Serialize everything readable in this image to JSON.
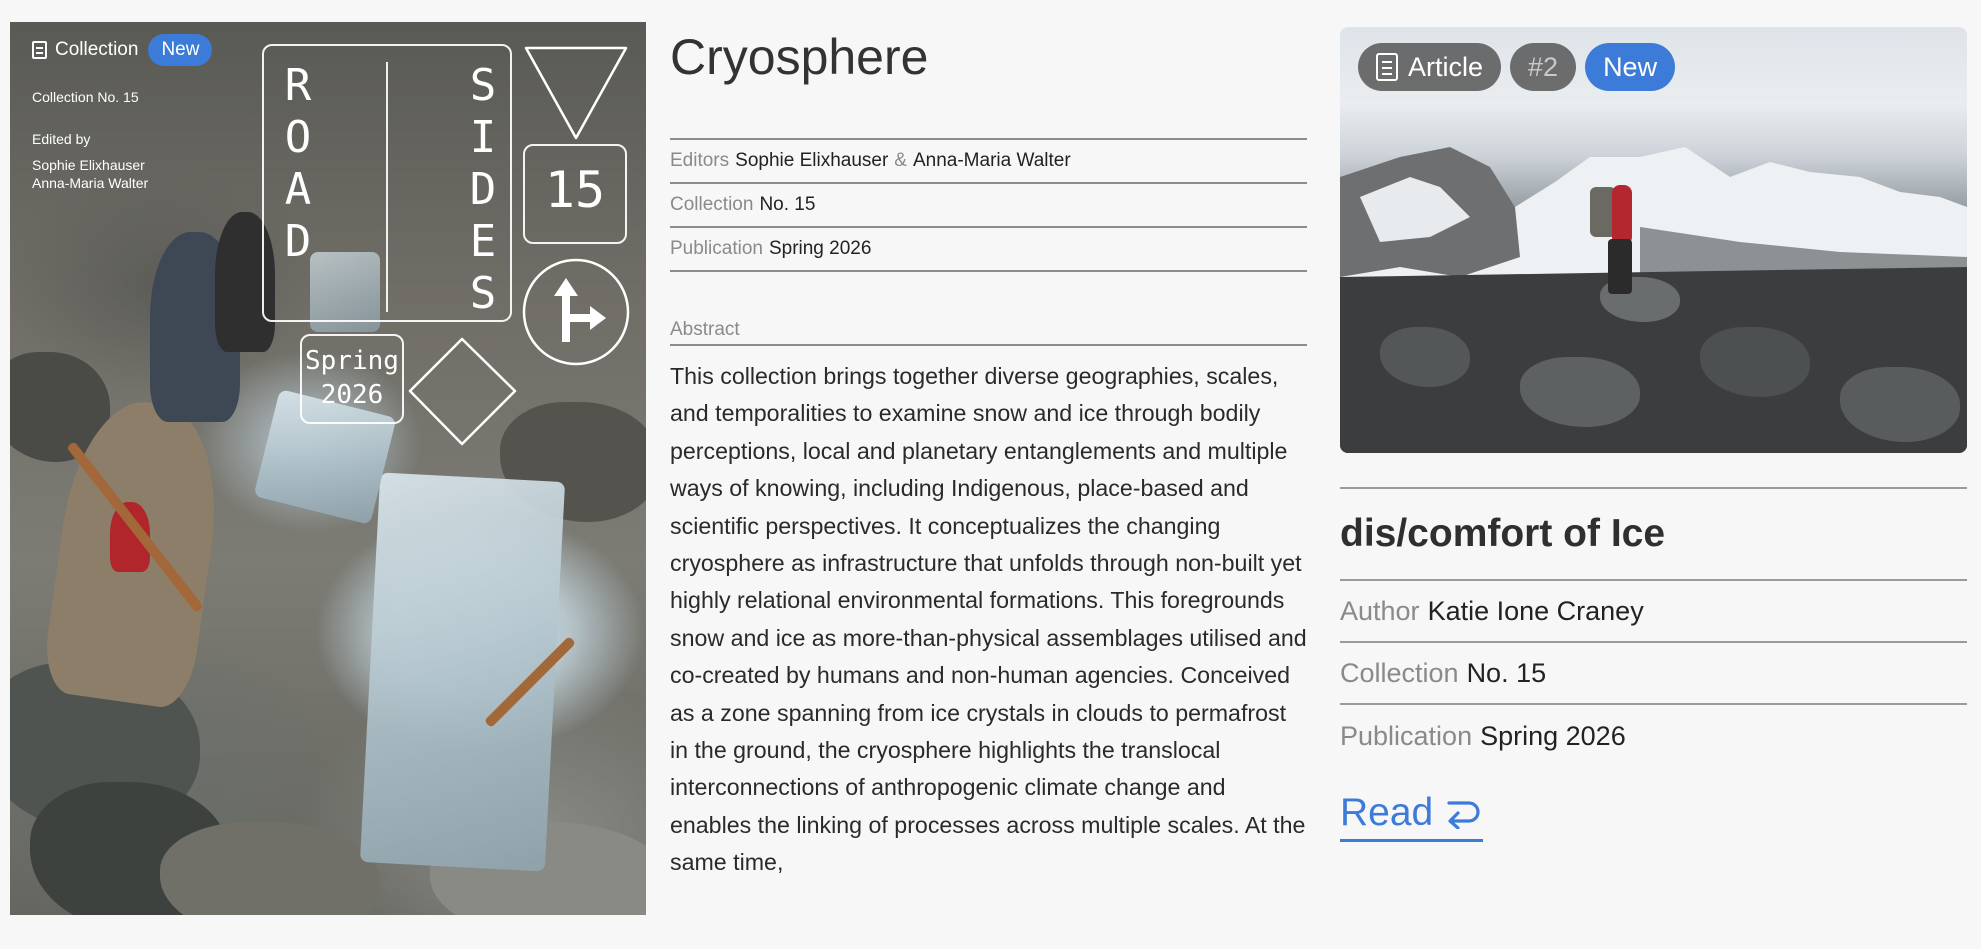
{
  "cover": {
    "collection_label": "Collection",
    "new_badge": "New",
    "collection_no": "Collection No. 15",
    "edited_by": "Edited by",
    "editor_1": "Sophie Elixhauser",
    "editor_2": "Anna-Maria Walter",
    "logo_word_1": "ROAD",
    "logo_word_2": "SIDES",
    "logo_number": "15",
    "logo_season": "Spring",
    "logo_year": "2026"
  },
  "collection": {
    "title": "Cryosphere",
    "editors_key": "Editors",
    "editor_1": "Sophie Elixhauser",
    "amp": "&",
    "editor_2": "Anna-Maria Walter",
    "collection_key": "Collection",
    "collection_value": "No. 15",
    "publication_key": "Publication",
    "publication_value": "Spring 2026",
    "abstract_label": "Abstract",
    "abstract_text": "This collection brings together diverse geographies, scales, and temporalities to examine snow and ice through bodily perceptions, local and planetary entanglements and multiple ways of knowing, including Indigenous, place-based and scientific perspectives. It conceptualizes the changing cryosphere as infrastructure that unfolds through non-built yet highly relational environmental formations. This foregrounds snow and ice as more-than-physical assemblages utilised and co-created by humans and non-human agencies. Conceived as a zone spanning from ice crystals in clouds to permafrost in the ground, the cryosphere highlights the translocal interconnections of anthropogenic climate change and enables the linking of processes across multiple scales. At the same time,"
  },
  "article": {
    "type_label": "Article",
    "number_badge": "#2",
    "new_badge": "New",
    "title": "dis/comfort of Ice",
    "author_key": "Author",
    "author_value": "Katie Ione Craney",
    "collection_key": "Collection",
    "collection_value": "No. 15",
    "publication_key": "Publication",
    "publication_value": "Spring 2026",
    "read_label": "Read",
    "read_icon": "arrow-return-icon"
  },
  "colors": {
    "accent": "#3d7bd9",
    "muted_text": "#8a8a8a"
  }
}
